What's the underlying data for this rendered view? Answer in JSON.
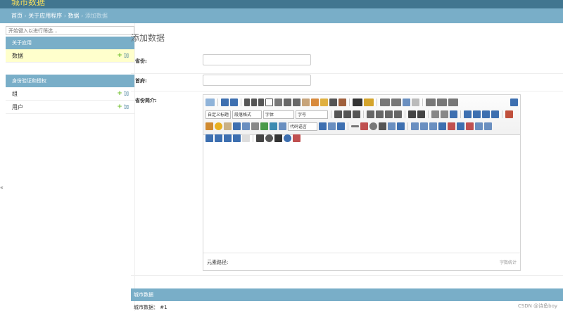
{
  "header": {
    "site_title": "城市数据",
    "top_links": ""
  },
  "breadcrumbs": {
    "home": "首页",
    "app": "关于应用程序",
    "model": "数据",
    "current": "添加数据",
    "sep": "›"
  },
  "sidebar": {
    "filter_placeholder": "开始键入以进行筛选...",
    "modules": [
      {
        "caption": "关于应用",
        "rows": [
          {
            "label": "数据",
            "add": "加"
          }
        ]
      },
      {
        "caption": "身份验证和授权",
        "rows": [
          {
            "label": "组",
            "add": "加"
          },
          {
            "label": "用户",
            "add": "加"
          }
        ]
      }
    ]
  },
  "content": {
    "title": "添加数据",
    "fields": [
      {
        "label": "省份:",
        "value": ""
      },
      {
        "label": "首府:",
        "value": ""
      },
      {
        "label": "省份简介:"
      }
    ],
    "editor": {
      "combos": [
        "自定义标题",
        "段落格式",
        "字体",
        "字号",
        "代码语言"
      ],
      "status_path": "元素路径:",
      "word_count": "字数统计"
    },
    "inline": {
      "caption": "城市数据",
      "row": "城市数据：  #1"
    }
  },
  "edge_toggle": "«",
  "watermark": "CSDN @诗鱼boy"
}
